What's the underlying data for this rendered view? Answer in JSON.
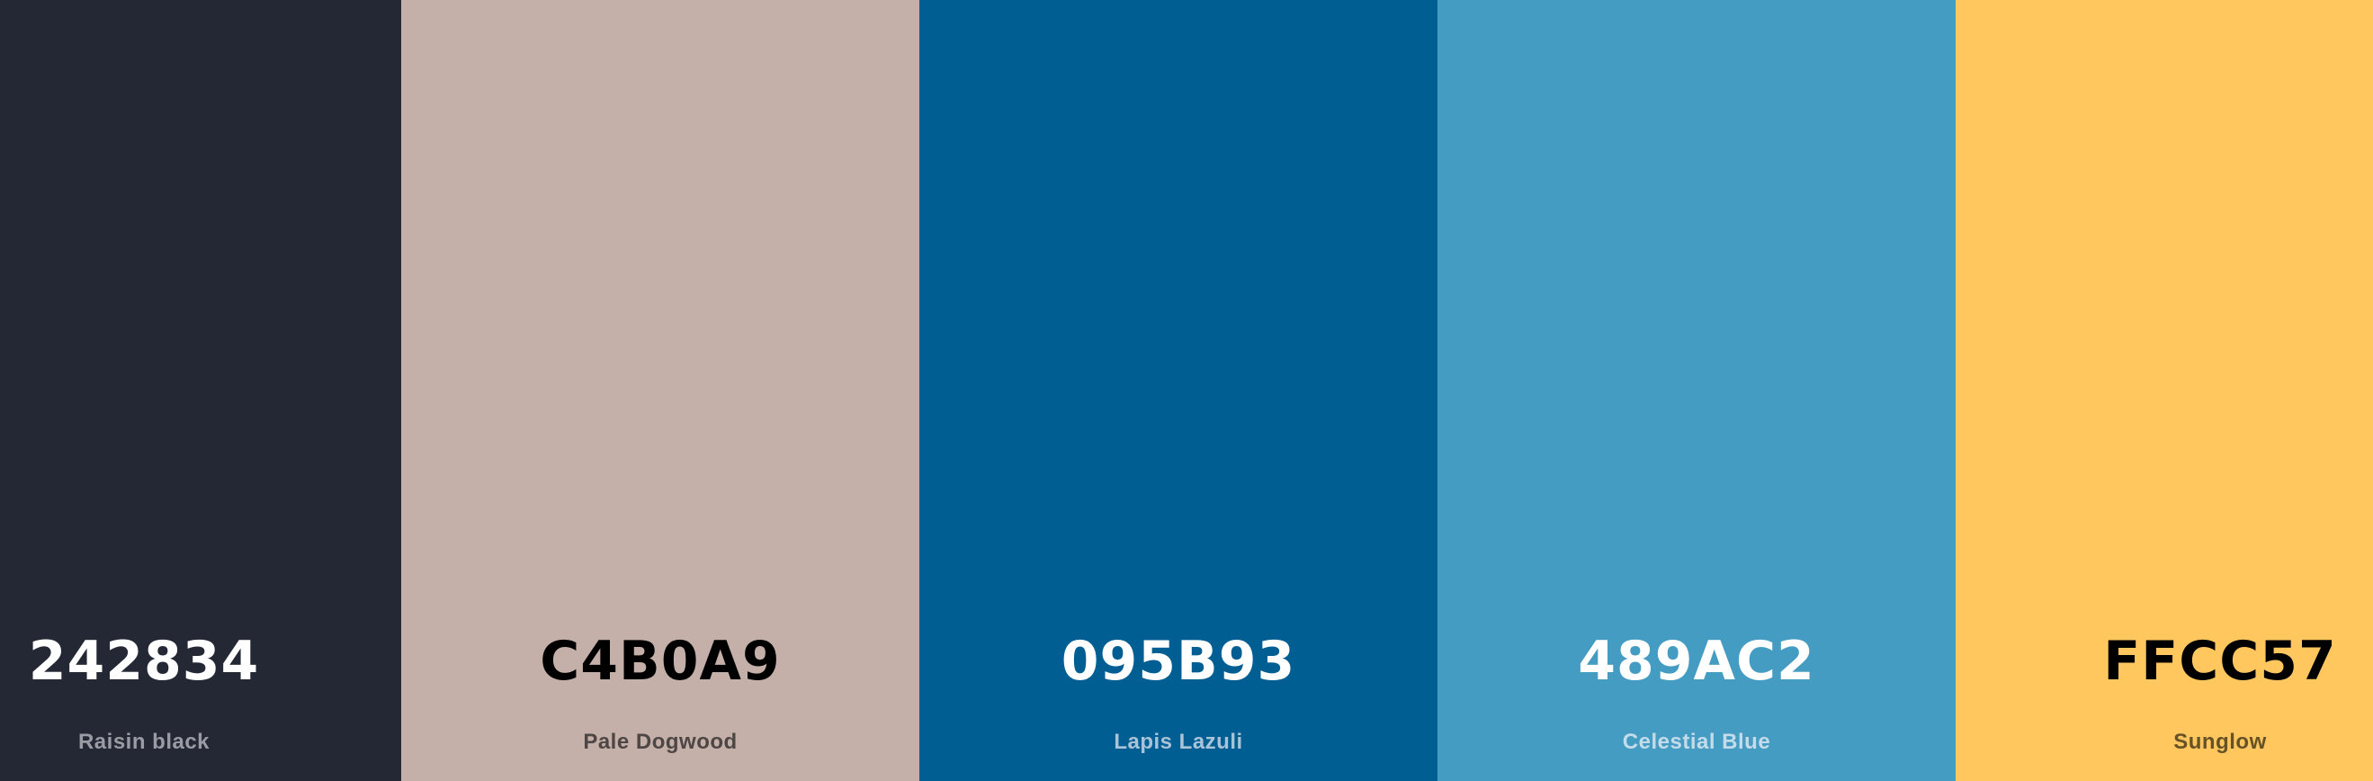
{
  "palette": {
    "swatches": [
      {
        "hex": "242834",
        "name": "Raisin black",
        "color": "#242834",
        "hex_text_color": "#FFFFFF",
        "name_text_color": "#9A9CA3"
      },
      {
        "hex": "C4B0A9",
        "name": "Pale Dogwood",
        "color": "#C4B0A9",
        "hex_text_color": "#000000",
        "name_text_color": "#4E4644"
      },
      {
        "hex": "095B93",
        "name": "Lapis Lazuli",
        "color": "#005E93",
        "hex_text_color": "#FFFFFF",
        "name_text_color": "#A9C4D8"
      },
      {
        "hex": "489AC2",
        "name": "Celestial Blue",
        "color": "#459CC2",
        "hex_text_color": "#FFFFFF",
        "name_text_color": "#C4DCEA"
      },
      {
        "hex": "FFCC57",
        "name": "Sunglow",
        "color": "#FFC75E",
        "hex_text_color": "#000000",
        "name_text_color": "#665226"
      }
    ]
  }
}
